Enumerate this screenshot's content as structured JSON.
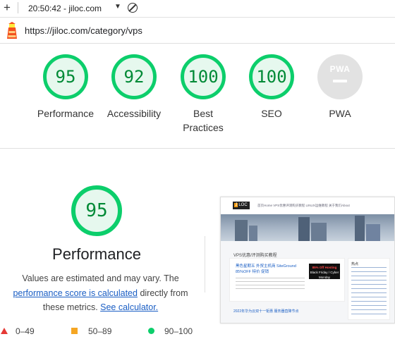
{
  "toolbar": {
    "time_text": "20:50:42 - jiloc.com"
  },
  "address": {
    "url": "https://jiloc.com/category/vps"
  },
  "gauges": [
    {
      "label": "Performance",
      "score": "95"
    },
    {
      "label": "Accessibility",
      "score": "92"
    },
    {
      "label": "Best",
      "label2": "Practices",
      "score": "100"
    },
    {
      "label": "SEO",
      "score": "100"
    },
    {
      "label": "PWA",
      "score": ""
    }
  ],
  "pwa_badge": "PWA",
  "performance": {
    "score": "95",
    "title": "Performance",
    "desc_1": "Values are estimated and may vary. The",
    "link_calc": "performance score is calculated",
    "desc_2": " directly from",
    "desc_3": "these metrics. ",
    "link_see": "See calculator."
  },
  "legend": {
    "fail": "0–49",
    "average": "50–89",
    "pass": "90–100"
  },
  "thumbnail": {
    "logo": "LOC",
    "nav": "首页Home   VPS优惠评测购买教程   LINUX运维教程   关于我们About",
    "heading": "VPS优惠/评测购买教程",
    "post_title": "黑色星期五 外贸主机商 SiteGround 85%OFF 特价 促销",
    "ad_title": "85% Off Hosting",
    "ad_sub": "Black Friday / Cyber Monday",
    "sidebar_title": "热点",
    "footer_link": "2022年华为云双十一钜惠 服务器直降节点"
  },
  "colors": {
    "pass": "#0cce6b",
    "pass_text": "#008a36",
    "average": "#f5a623",
    "fail": "#e53935",
    "link": "#1a5ec4"
  }
}
